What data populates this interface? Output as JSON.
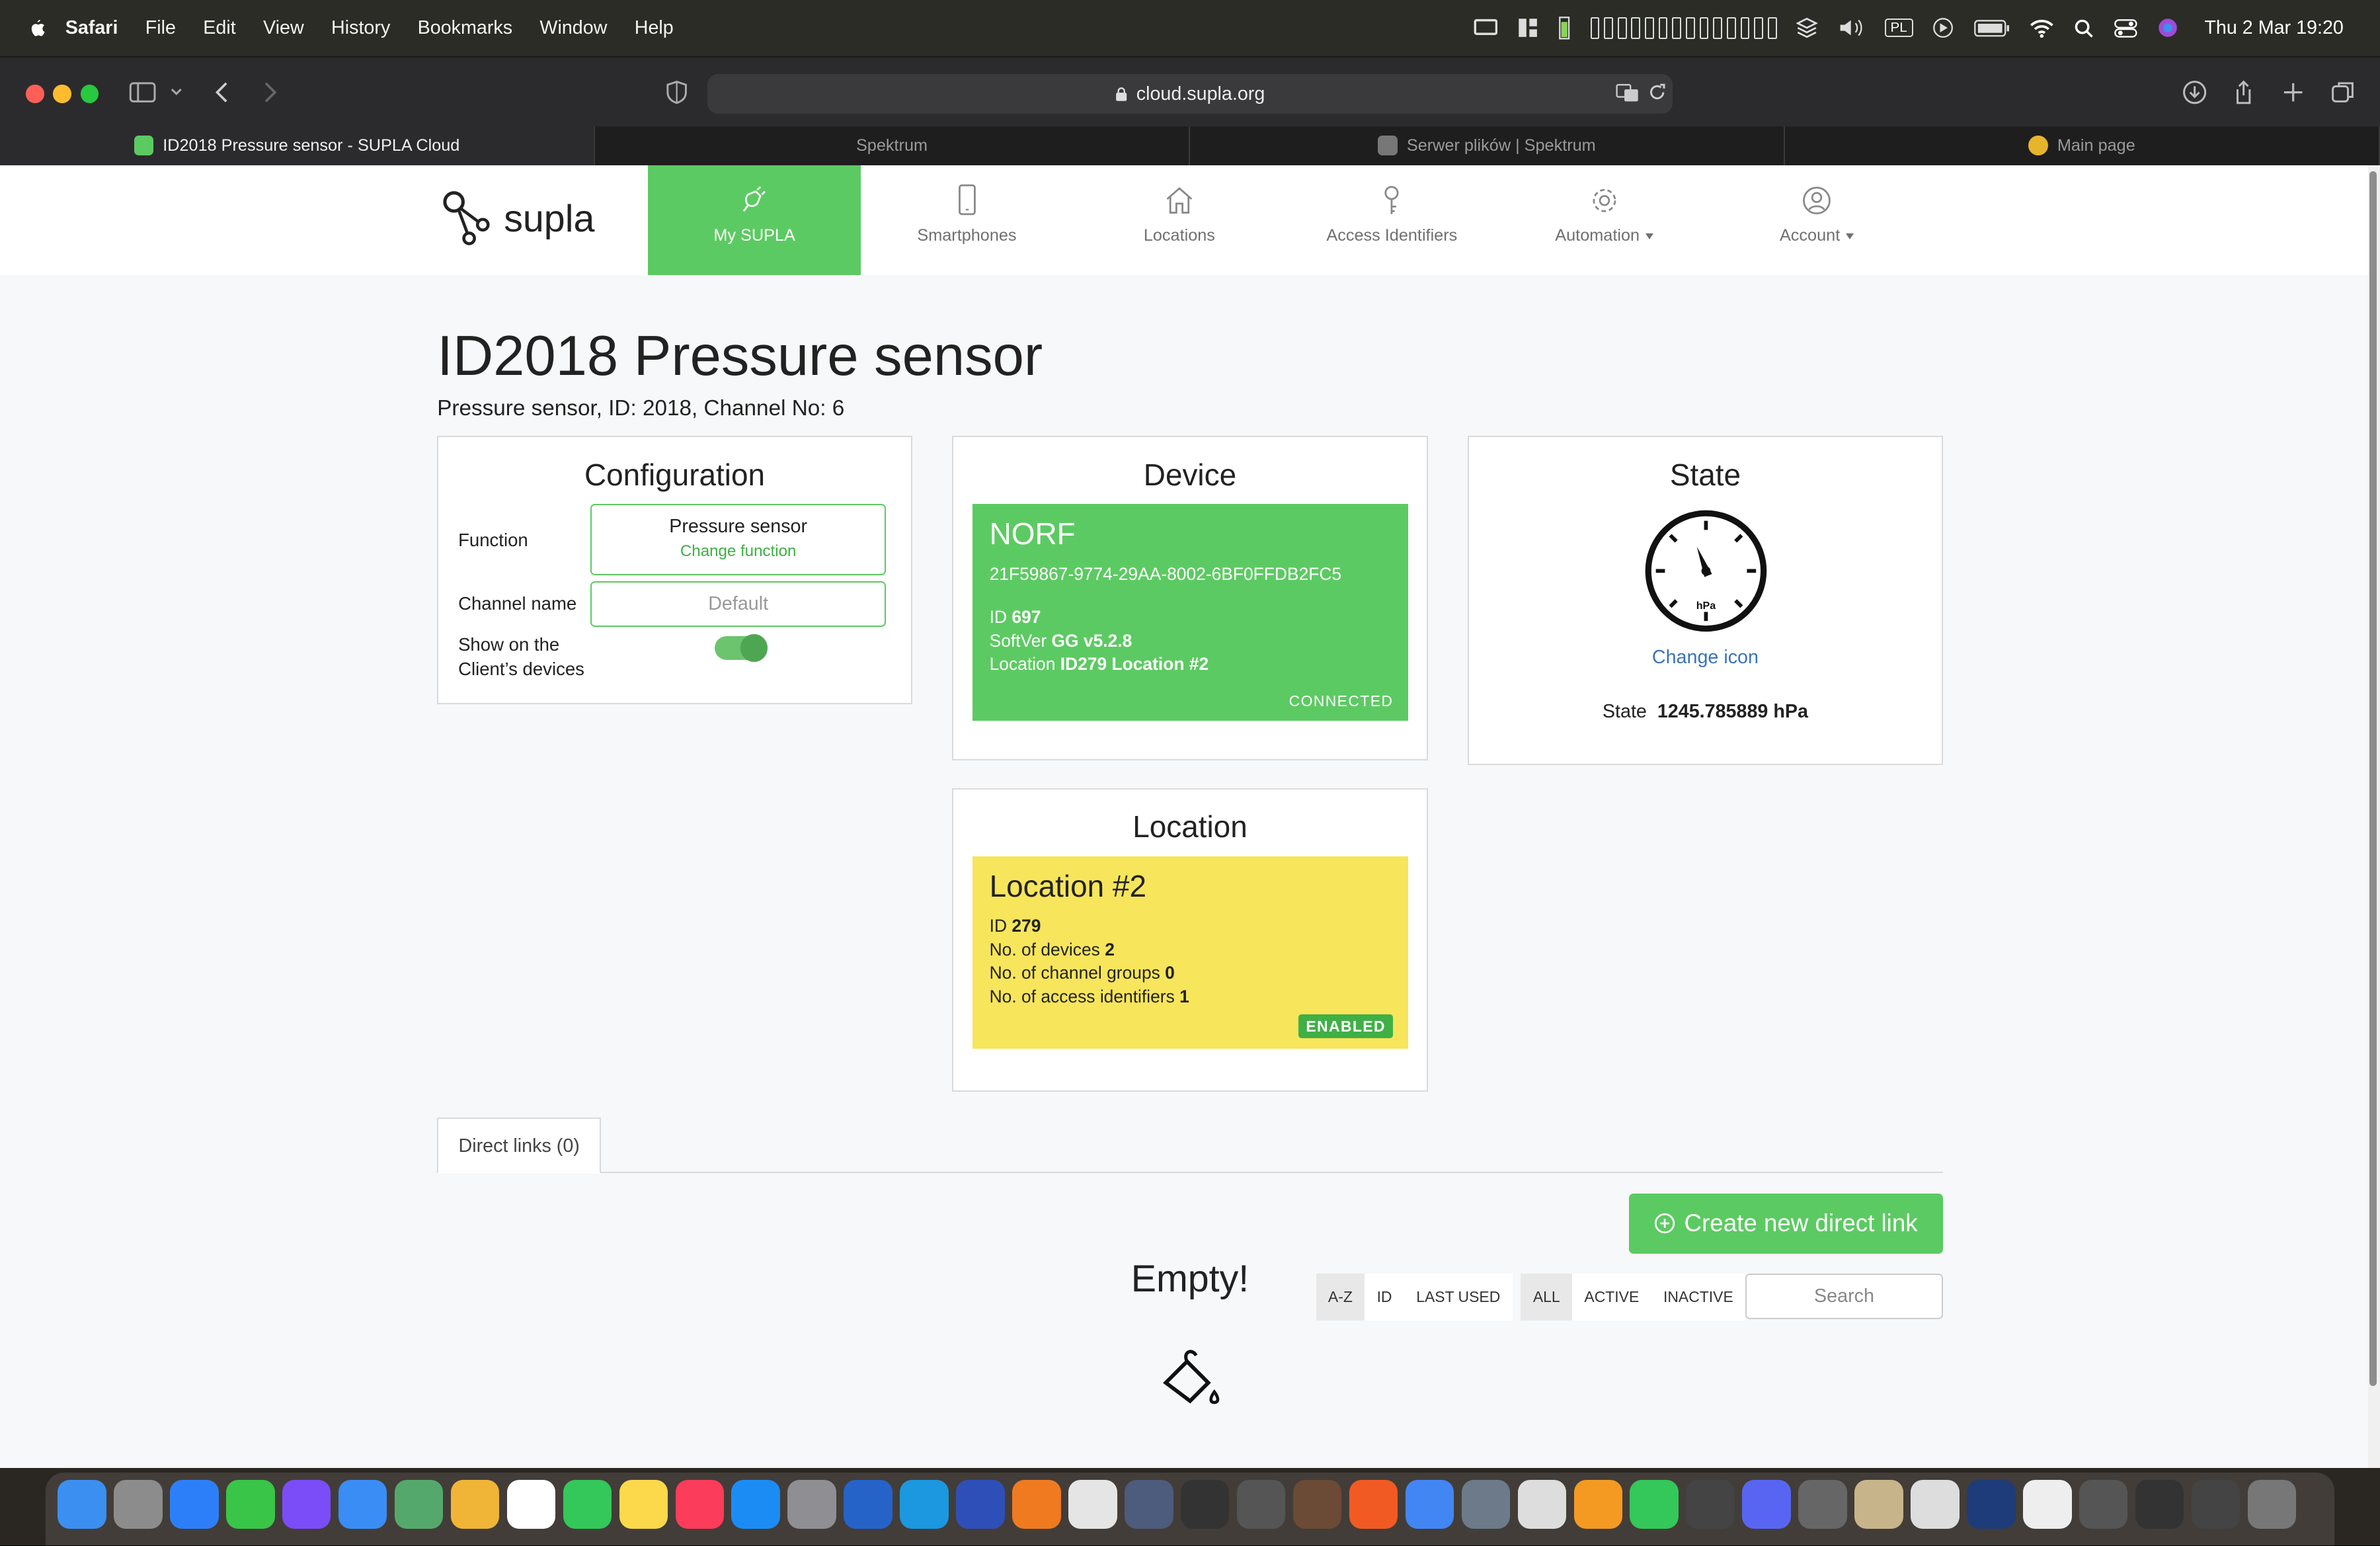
{
  "menubar": {
    "app": "Safari",
    "items": [
      "File",
      "Edit",
      "View",
      "History",
      "Bookmarks",
      "Window",
      "Help"
    ],
    "input_lang": "PL",
    "clock": "Thu 2 Mar  19:20"
  },
  "browser": {
    "url": "cloud.supla.org",
    "tabs": [
      {
        "label": "ID2018 Pressure sensor - SUPLA Cloud",
        "active": true
      },
      {
        "label": "Spektrum",
        "active": false
      },
      {
        "label": "Serwer plików | Spektrum",
        "active": false
      },
      {
        "label": "Main page",
        "active": false
      }
    ]
  },
  "nav": {
    "logo": "supla",
    "items": [
      {
        "label": "My SUPLA",
        "icon": "plug-icon"
      },
      {
        "label": "Smartphones",
        "icon": "smartphone-icon"
      },
      {
        "label": "Locations",
        "icon": "home-icon"
      },
      {
        "label": "Access Identifiers",
        "icon": "key-icon"
      },
      {
        "label": "Automation",
        "icon": "gear-icon"
      },
      {
        "label": "Account",
        "icon": "user-icon"
      }
    ]
  },
  "page": {
    "title": "ID2018 Pressure sensor",
    "subtitle": "Pressure sensor, ID: 2018, Channel No: 6"
  },
  "configuration": {
    "heading": "Configuration",
    "function_label": "Function",
    "function_value": "Pressure sensor",
    "change_function": "Change function",
    "channel_name_label": "Channel name",
    "channel_name_placeholder": "Default",
    "show_label_1": "Show on the",
    "show_label_2": "Client’s devices",
    "show_enabled": true
  },
  "device": {
    "heading": "Device",
    "name": "NORF",
    "guid": "21F59867-9774-29AA-8002-6BF0FFDB2FC5",
    "id_label": "ID",
    "id": "697",
    "softver_label": "SoftVer",
    "softver": "GG v5.2.8",
    "location_label": "Location",
    "location": "ID279 Location #2",
    "status": "CONNECTED"
  },
  "state": {
    "heading": "State",
    "gauge_unit": "hPa",
    "change_icon": "Change icon",
    "state_label": "State",
    "state_value": "1245.785889 hPa"
  },
  "location": {
    "heading": "Location",
    "name": "Location #2",
    "id_label": "ID",
    "id": "279",
    "devices_label": "No. of devices",
    "devices": "2",
    "groups_label": "No. of channel groups",
    "groups": "0",
    "access_label": "No. of access identifiers",
    "access": "1",
    "status": "ENABLED"
  },
  "direct_links": {
    "tab": "Direct links (0)",
    "create": "Create new direct link",
    "sort": [
      "A-Z",
      "ID",
      "LAST USED"
    ],
    "filter": [
      "ALL",
      "ACTIVE",
      "INACTIVE"
    ],
    "search_placeholder": "Search",
    "empty": "Empty!"
  },
  "colors": {
    "accent": "#5cca62",
    "location_tile": "#f7e55c",
    "link": "#3a74b6"
  }
}
